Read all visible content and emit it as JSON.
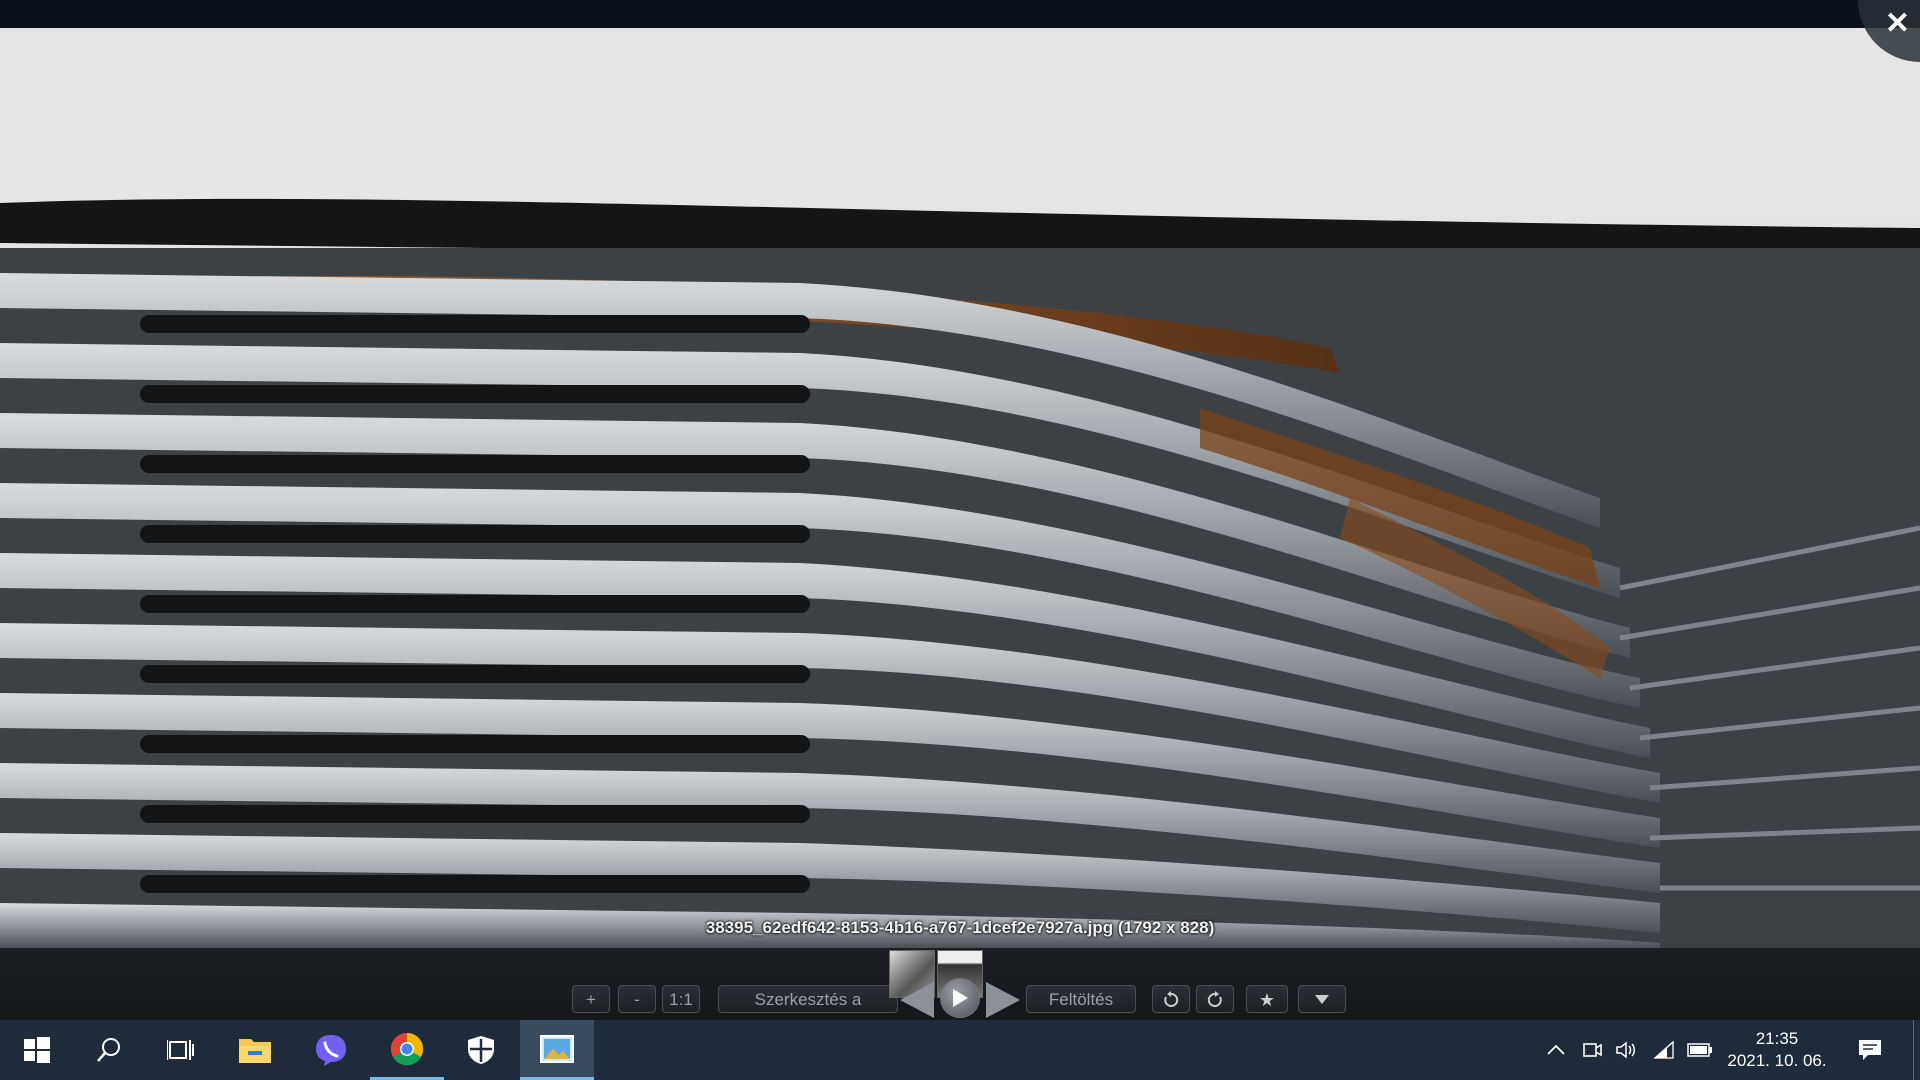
{
  "viewer": {
    "close_icon": "close-icon",
    "caption": "38395_62edf642-8153-4b16-a767-1dcef2e7927a.jpg (1792 x 828)"
  },
  "controls": {
    "zoom_in_label": "+",
    "zoom_out_label": "-",
    "actual_size_label": "1:1",
    "edit_label": "Szerkesztés a Picasában",
    "upload_label": "Feltöltés",
    "rotate_left_icon": "rotate-left-icon",
    "rotate_right_icon": "rotate-right-icon",
    "star_icon": "star-icon",
    "more_icon": "chevron-down-icon",
    "prev_icon": "arrow-left-icon",
    "next_icon": "arrow-right-icon",
    "play_icon": "play-icon"
  },
  "taskbar": {
    "apps": [
      "start-icon",
      "search-icon",
      "task-view-icon",
      "file-explorer-icon",
      "viber-icon",
      "chrome-icon",
      "security-icon",
      "photo-viewer-icon"
    ],
    "tray": [
      "chevron-up-icon",
      "meet-icon",
      "volume-icon",
      "wifi-icon",
      "battery-icon"
    ],
    "time": "21:35",
    "date": "2021. 10. 06.",
    "notification_icon": "notification-icon"
  }
}
